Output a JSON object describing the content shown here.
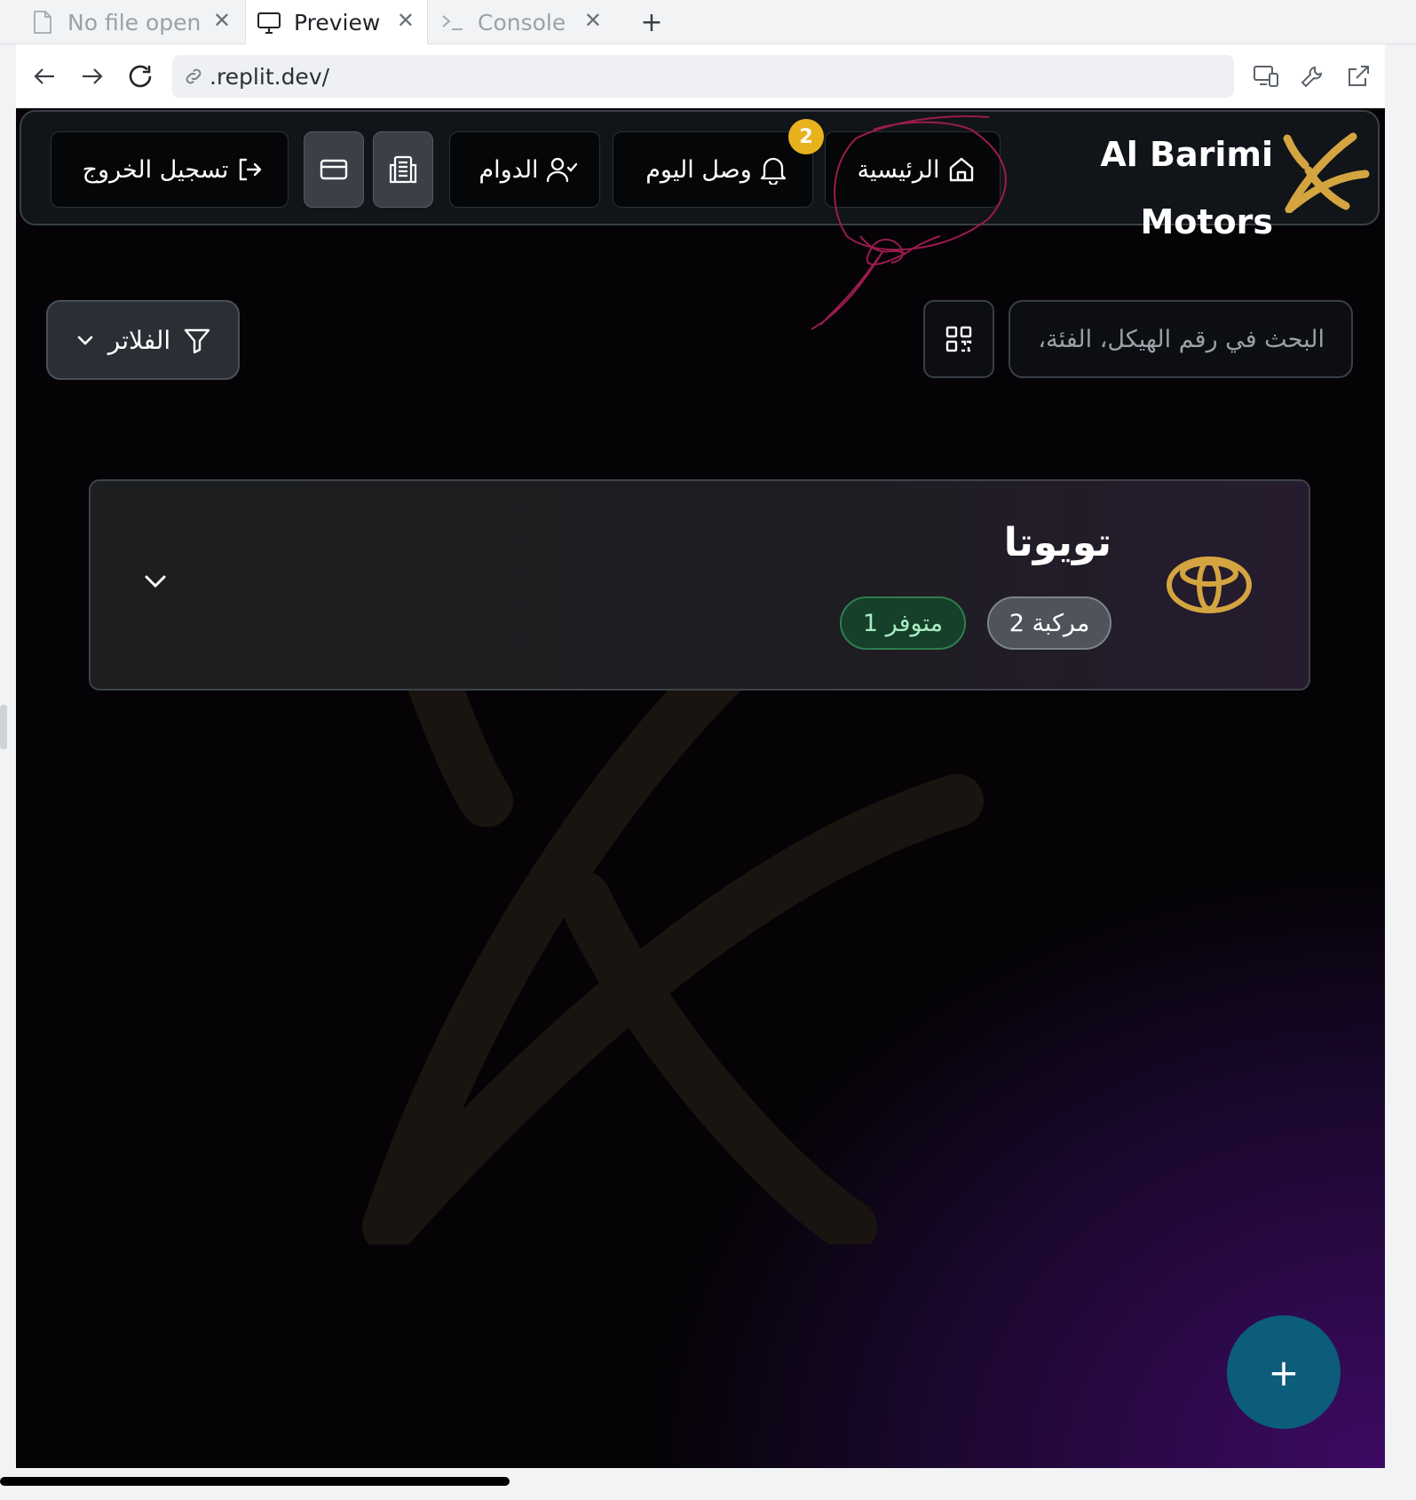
{
  "browser": {
    "tabs": [
      {
        "label": "No file open",
        "icon": "file-icon"
      },
      {
        "label": "Preview",
        "icon": "monitor-icon"
      },
      {
        "label": "Console",
        "icon": "terminal-icon"
      }
    ],
    "new_tab": "+",
    "url": ".replit.dev/"
  },
  "header": {
    "brand_line1": "Al Barimi",
    "brand_line2": "Motors",
    "home_label": "الرئيسية",
    "today_label": "وصل اليوم",
    "notification_count": "2",
    "attendance_label": "الدوام",
    "logout_label": "تسجيل الخروج",
    "accent_color": "#d4a441"
  },
  "toolbar": {
    "search_placeholder": "البحث في رقم الهيكل، الفئة،",
    "filters_label": "الفلاتر"
  },
  "brand_group": {
    "name": "تويوتا",
    "vehicle_count": "2 مركبة",
    "available_count": "1 متوفر"
  },
  "fab_label": "+"
}
